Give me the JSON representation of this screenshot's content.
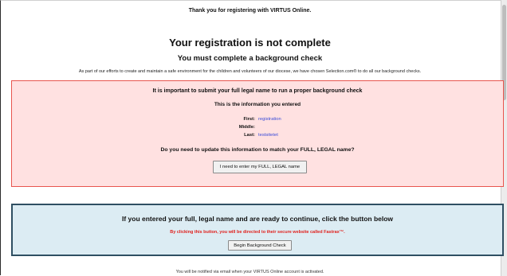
{
  "header": {
    "thanks": "Thank you for registering with VIRTUS Online."
  },
  "main": {
    "title": "Your registration is not complete",
    "subtitle": "You must complete a background check",
    "intro": "As part of our efforts to create and maintain a safe environment for the children and volunteers of our diocese, we have chosen Selection.com® to do all our background checks."
  },
  "legal_name_box": {
    "warning": "It is important to submit your full legal name to run a proper background check",
    "info_title": "This is the information you entered",
    "first_label": "First:",
    "first_value": "registration",
    "middle_label": "Middle:",
    "middle_value": "",
    "last_label": "Last:",
    "last_value": "testsitetet",
    "question": "Do you need to update this information to match your FULL, LEGAL name?",
    "update_button": "I need to enter my FULL, LEGAL name",
    "colors": {
      "background": "#ffe1e1",
      "border": "#e8554e",
      "value": "#3a4bd8"
    }
  },
  "continue_box": {
    "heading": "If you entered your full, legal name and are ready to continue, click the button below",
    "redirect_note": "By clicking this button, you will be directed to their secure website called Fastrax™.",
    "begin_button": "Begin Background Check",
    "colors": {
      "background": "#dcecf3",
      "border": "#2f4f62",
      "note": "#e0201c"
    }
  },
  "footer": {
    "notify": "You will be notified via email when your VIRTUS Online account is activated."
  }
}
